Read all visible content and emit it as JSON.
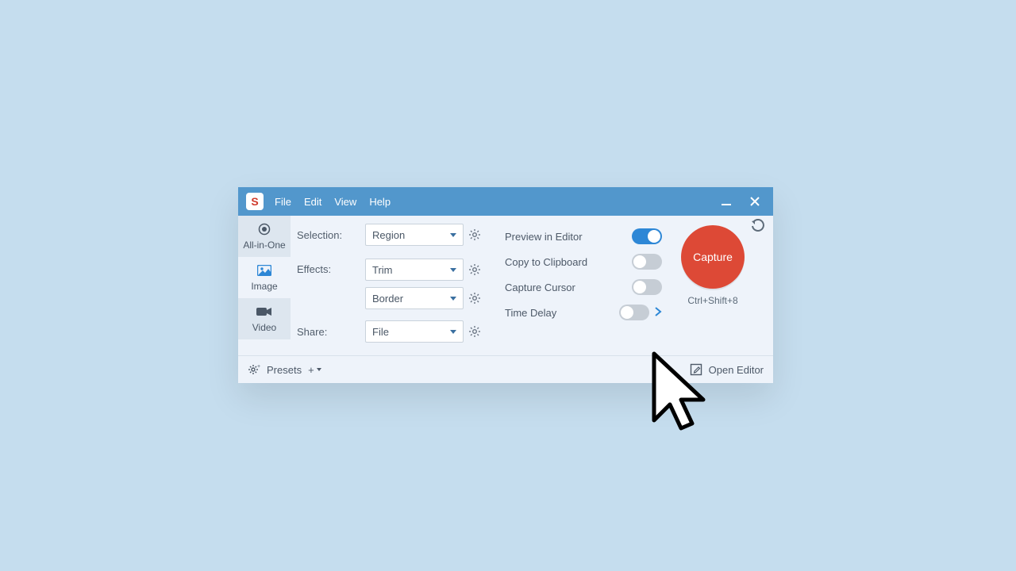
{
  "logo_letter": "S",
  "menus": {
    "file": "File",
    "edit": "Edit",
    "view": "View",
    "help": "Help"
  },
  "tabs": {
    "allinone": "All-in-One",
    "image": "Image",
    "video": "Video"
  },
  "labels": {
    "selection": "Selection:",
    "effects": "Effects:",
    "share": "Share:"
  },
  "dropdowns": {
    "region": "Region",
    "trim": "Trim",
    "border": "Border",
    "file": "File"
  },
  "options": {
    "preview": "Preview in Editor",
    "clipboard": "Copy to Clipboard",
    "cursor": "Capture Cursor",
    "delay": "Time Delay"
  },
  "capture": {
    "label": "Capture",
    "hotkey": "Ctrl+Shift+8"
  },
  "footer": {
    "presets": "Presets",
    "plus": "+",
    "open_editor": "Open Editor"
  }
}
